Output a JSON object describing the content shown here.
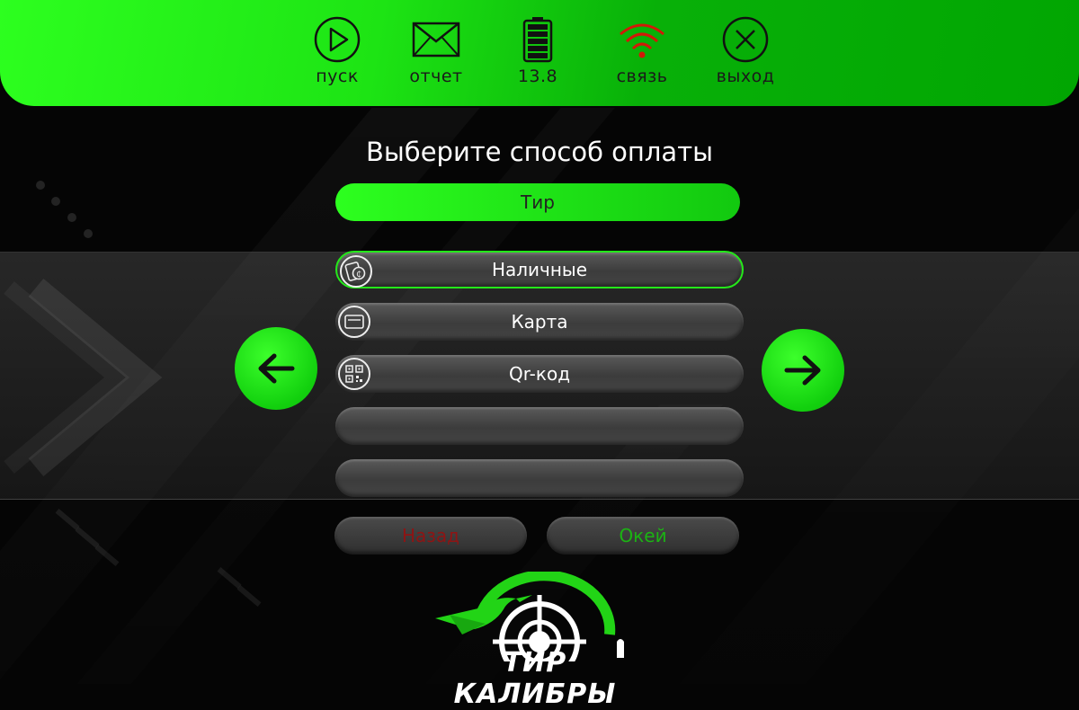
{
  "toolbar": {
    "start_label": "пуск",
    "report_label": "отчет",
    "battery_value": "13.8",
    "connection_label": "связь",
    "exit_label": "выход"
  },
  "title": "Выберите способ оплаты",
  "mode_label": "Тир",
  "payment_options": [
    {
      "label": "Наличные",
      "icon": "cash-icon",
      "selected": true
    },
    {
      "label": "Карта",
      "icon": "card-icon",
      "selected": false
    },
    {
      "label": "Qr-код",
      "icon": "qr-icon",
      "selected": false
    },
    {
      "label": "",
      "icon": "",
      "selected": false
    },
    {
      "label": "",
      "icon": "",
      "selected": false
    }
  ],
  "buttons": {
    "back_label": "Назад",
    "ok_label": "Окей"
  },
  "logo_text": "ТИР КАЛИБРЫ",
  "colors": {
    "accent": "#1de414",
    "back_text": "#8e1414",
    "ok_text": "#1bb313",
    "wifi": "#d11a08"
  }
}
